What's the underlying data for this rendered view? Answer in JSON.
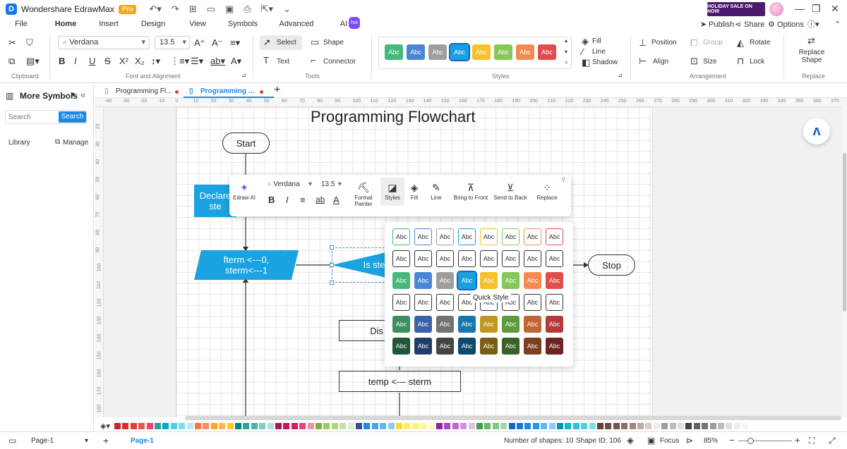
{
  "app": {
    "name": "Wondershare EdrawMax",
    "badge": "Pro",
    "promo": "HOLIDAY SALE ON NOW"
  },
  "menu": {
    "tabs": [
      "File",
      "Home",
      "Insert",
      "Design",
      "View",
      "Symbols",
      "Advanced",
      "AI"
    ],
    "ai_badge": "hot",
    "publish": "Publish",
    "share": "Share",
    "options": "Options"
  },
  "ribbon": {
    "font_name": "Verdana",
    "font_size": "13.5",
    "clipboard_label": "Clipboard",
    "font_label": "Font and Alignment",
    "tools_label": "Tools",
    "styles_label": "Styles",
    "arrangement_label": "Arrangement",
    "replace_group_label": "Replace",
    "select": "Select",
    "shape": "Shape",
    "text": "Text",
    "connector": "Connector",
    "style_sample": "Abc",
    "fill": "Fill",
    "line": "Line",
    "shadow": "Shadow",
    "position": "Position",
    "group": "Group",
    "rotate": "Rotate",
    "align": "Align",
    "size": "Size",
    "lock": "Lock",
    "replace_shape": "Replace Shape",
    "style_colors": [
      "#45b97c",
      "#4a86d6",
      "#9e9e9e",
      "#1a9fe0",
      "#f7c12d",
      "#86c75a",
      "#f48a52",
      "#e04d4d"
    ]
  },
  "left_panel": {
    "title": "More Symbols",
    "search_placeholder": "Search",
    "search_button": "Search",
    "library": "Library",
    "manage": "Manage"
  },
  "doc_tabs": [
    "Programming Fl...",
    "Programming ..."
  ],
  "hruler": [
    "-40",
    "-30",
    "-20",
    "-10",
    "0",
    "10",
    "20",
    "30",
    "40",
    "50",
    "60",
    "70",
    "80",
    "90",
    "100",
    "110",
    "120",
    "130",
    "140",
    "150",
    "160",
    "170",
    "180",
    "190",
    "200",
    "210",
    "220",
    "230",
    "240",
    "250",
    "260",
    "270",
    "280",
    "290",
    "300",
    "310",
    "320",
    "330",
    "340",
    "350",
    "360",
    "370"
  ],
  "vruler": [
    "20",
    "30",
    "40",
    "50",
    "60",
    "70",
    "80",
    "90",
    "100",
    "110",
    "120",
    "130",
    "140",
    "150",
    "160",
    "170",
    "180"
  ],
  "flowchart": {
    "title": "Programming Flowchart",
    "start": "Start",
    "declare": "Declare\nste",
    "init": "fterm <---0,\nsterm<---1",
    "decision": "Is ste",
    "stop": "Stop",
    "display": "Dis",
    "temp": "temp <--- sterm"
  },
  "floatbar": {
    "font": "Verdana",
    "size": "13.5",
    "edraw_ai": "Edraw AI",
    "format_painter": "Format Painter",
    "styles": "Styles",
    "fill": "Fill",
    "line": "Line",
    "bring_front": "Bring to Front",
    "send_back": "Send to Back",
    "replace": "Replace"
  },
  "quick_style": {
    "tooltip": "Quick Style",
    "sample": "Abc",
    "row_fills": [
      [
        "#ffffff",
        "#ffffff",
        "#ffffff",
        "#ffffff",
        "#ffffff",
        "#ffffff",
        "#ffffff",
        "#ffffff"
      ],
      [
        "#ffffff",
        "#ffffff",
        "#ffffff",
        "#ffffff",
        "#ffffff",
        "#ffffff",
        "#ffffff",
        "#ffffff"
      ],
      [
        "#45b97c",
        "#4a86d6",
        "#9e9e9e",
        "#1a9fe0",
        "#f7c12d",
        "#86c75a",
        "#f48a52",
        "#e04d4d"
      ],
      [
        "#ffffff",
        "#ffffff",
        "#ffffff",
        "#ffffff",
        "#ffffff",
        "#ffffff",
        "#ffffff",
        "#ffffff"
      ],
      [
        "#3a8f5e",
        "#3a62a8",
        "#737373",
        "#1478ad",
        "#c2961f",
        "#5f9a3c",
        "#c06634",
        "#b43a3a"
      ],
      [
        "#22553a",
        "#233d6b",
        "#444444",
        "#0c4a6b",
        "#7a5e12",
        "#3b6226",
        "#7a4020",
        "#702323"
      ]
    ],
    "row1_borders": [
      "#45b97c",
      "#4a86d6",
      "#9e9e9e",
      "#1a9fe0",
      "#f7c12d",
      "#86c75a",
      "#f48a52",
      "#e04d4d"
    ]
  },
  "status": {
    "page_selector": "Page-1",
    "page_tab": "Page-1",
    "shapes": "Number of shapes: 10",
    "shape_id": "Shape ID: 106",
    "focus": "Focus",
    "zoom": "85%"
  },
  "palette": [
    "#c62828",
    "#d32f2f",
    "#e53935",
    "#ef5350",
    "#ec407a",
    "#26a69a",
    "#00acc1",
    "#4dd0e1",
    "#80deea",
    "#b2ebf2",
    "#ff7043",
    "#ff8a65",
    "#ffa726",
    "#ffb74d",
    "#ffca28",
    "#00897b",
    "#26a69a",
    "#4db6ac",
    "#80cbc4",
    "#b2dfdb",
    "#ad1457",
    "#c2185b",
    "#d81b60",
    "#ec407a",
    "#f48fb1",
    "#7cb342",
    "#9ccc65",
    "#aed581",
    "#c5e1a5",
    "#dcedc8",
    "#3949ab",
    "#1e88e5",
    "#42a5f5",
    "#64b5f6",
    "#90caf9",
    "#fdd835",
    "#ffee58",
    "#fff176",
    "#fff59d",
    "#fff9c4",
    "#8e24aa",
    "#ab47bc",
    "#ba68c8",
    "#ce93d8",
    "#e1bee7",
    "#43a047",
    "#66bb6a",
    "#81c784",
    "#a5d6a7",
    "#1565c0",
    "#1976d2",
    "#1e88e5",
    "#2196f3",
    "#64b5f6",
    "#90caf9",
    "#0097a7",
    "#00bcd4",
    "#26c6da",
    "#4dd0e1",
    "#80deea",
    "#5d4037",
    "#6d4c41",
    "#795548",
    "#8d6e63",
    "#a1887f",
    "#bcaaa4",
    "#d7ccc8",
    "#efebe9",
    "#9e9e9e",
    "#bdbdbd",
    "#e0e0e0",
    "#424242",
    "#616161",
    "#757575",
    "#9e9e9e",
    "#bdbdbd",
    "#e0e0e0",
    "#eeeeee",
    "#f5f5f5"
  ]
}
